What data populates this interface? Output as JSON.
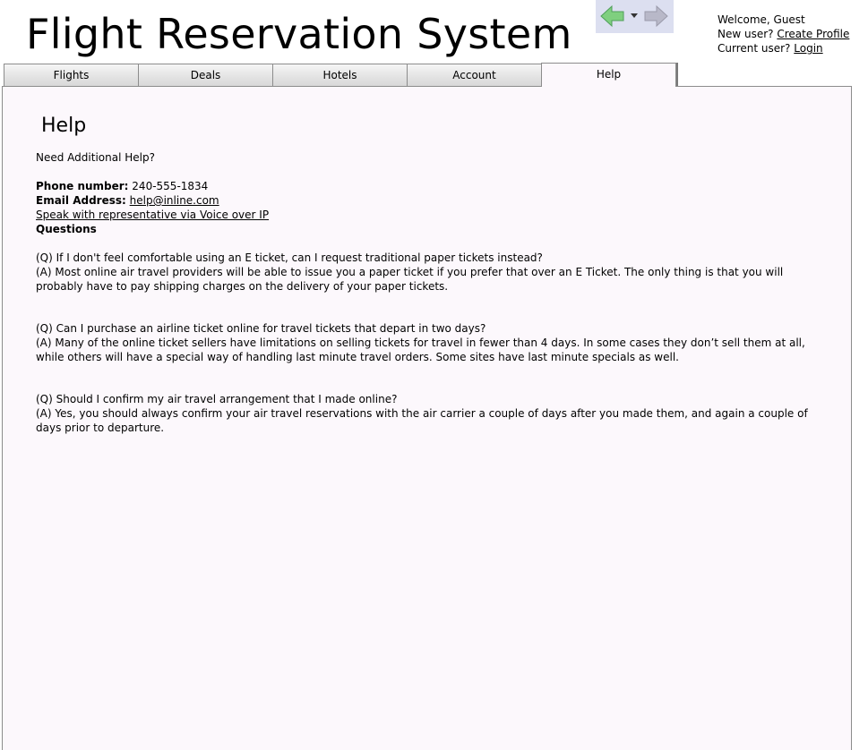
{
  "app": {
    "title": "Flight Reservation System"
  },
  "nav": {
    "back_icon": "back-arrow-icon",
    "dropdown_icon": "chevron-down-icon",
    "forward_icon": "forward-arrow-icon",
    "colors": {
      "panel": "#dcdff0",
      "back": "#7fcf7f",
      "forward": "#b8b8c8"
    }
  },
  "user": {
    "welcome": "Welcome, Guest",
    "new_user_label": "New user?",
    "create_profile_link": "Create Profile",
    "current_user_label": "Current user?",
    "login_link": "Login"
  },
  "tabs": [
    {
      "label": "Flights",
      "active": false
    },
    {
      "label": "Deals",
      "active": false
    },
    {
      "label": "Hotels",
      "active": false
    },
    {
      "label": "Account",
      "active": false
    },
    {
      "label": "Help",
      "active": true
    }
  ],
  "help": {
    "heading": "Help",
    "intro": "Need Additional Help?",
    "phone_label": "Phone number:",
    "phone_value": " 240-555-1834",
    "email_label": "Email Address:",
    "email_value": "help@inline.com",
    "voip_link": "Speak with representative via Voice over IP",
    "questions_label": "Questions",
    "faqs": [
      {
        "question": "(Q) If I don't feel comfortable using an E ticket, can I request traditional paper tickets instead?",
        "answer": "(A) Most online air travel providers will be able to issue you a paper ticket if you prefer that over an E Ticket. The only thing is that you will probably have to pay shipping charges on the delivery of your paper tickets."
      },
      {
        "question": "(Q) Can I purchase an airline ticket online for travel tickets that depart in two days?",
        "answer": "(A) Many of the online ticket sellers have limitations on selling tickets for travel in fewer than 4 days. In some cases they don’t sell them at all, while others will have a special way of handling last minute travel orders. Some sites have last minute specials as well."
      },
      {
        "question": "(Q) Should I confirm my air travel arrangement that I made online?",
        "answer": "(A) Yes, you should always confirm your air travel reservations with the air carrier a couple of days after you made them, and again a couple of days prior to departure."
      }
    ]
  }
}
